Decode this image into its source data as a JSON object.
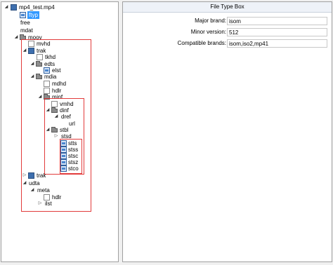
{
  "tree": {
    "root": "mp4_test.mp4",
    "ftyp": "ftyp",
    "free": "free",
    "mdat": "mdat",
    "moov": "moov",
    "mvhd": "mvhd",
    "trak1": "trak",
    "tkhd": "tkhd",
    "edts": "edts",
    "elst": "elst",
    "mdia": "mdia",
    "mdhd": "mdhd",
    "hdlr": "hdlr",
    "minf": "minf",
    "vmhd": "vmhd",
    "dinf": "dinf",
    "dref": "dref",
    "url": "url",
    "stbl": "stbl",
    "stsd": "stsd",
    "stts": "stts",
    "stss": "stss",
    "stsc": "stsc",
    "stsz": "stsz",
    "stco": "stco",
    "trak2": "trak",
    "udta": "udta",
    "meta": "meta",
    "hdlr2": "hdlr",
    "ilst": "ilst"
  },
  "detail": {
    "title": "File Type Box",
    "rows": [
      {
        "key": "Major brand:",
        "value": "isom"
      },
      {
        "key": "Minor version:",
        "value": "512"
      },
      {
        "key": "Compatible brands:",
        "value": "isom,iso2,mp41"
      }
    ]
  },
  "colors": {
    "highlight_box": "#e23b3b",
    "selection": "#3399ff"
  }
}
